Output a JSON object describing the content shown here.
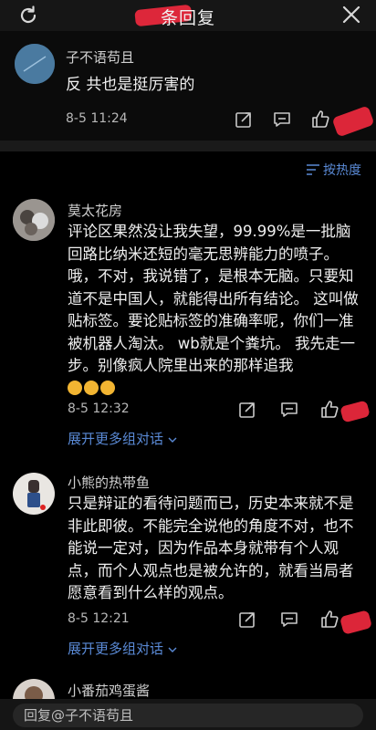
{
  "header": {
    "title": "条回复"
  },
  "root_comment": {
    "author": "子不语苟且",
    "content": "反 共也是挺厉害的",
    "time": "8-5 11:24"
  },
  "sort": {
    "label": "按热度"
  },
  "comments": [
    {
      "author": "莫太花房",
      "content": "评论区果然没让我失望，99.99%是一批脑回路比纳米还短的毫无思辨能力的喷子。哦，不对，我说错了，是根本无脑。只要知道不是中国人，就能得出所有结论。 这叫做贴标签。要论贴标签的准确率呢，你们一准被机器人淘汰。 wb就是个粪坑。 我先走一步。别像疯人院里出来的那样追我",
      "time": "8-5 12:32",
      "expand": "展开更多组对话"
    },
    {
      "author": "小熊的热带鱼",
      "content": "只是辩证的看待问题而已，历史本来就不是非此即彼。不能完全说他的角度不对，也不能说一定对，因为作品本身就带有个人观点，而个人观点也是被允许的，就看当局者愿意看到什么样的观点。",
      "time": "8-5 12:21",
      "expand": "展开更多组对话"
    },
    {
      "author": "小番茄鸡蛋酱"
    }
  ],
  "reply_input": {
    "placeholder": "回复@子不语苟且"
  },
  "icons": [
    "refresh-icon",
    "close-icon",
    "share-icon",
    "comment-icon",
    "like-icon",
    "sort-icon",
    "chevron-down-icon"
  ],
  "colors": {
    "background": "#000000",
    "link": "#5a8ad6",
    "redaction": "#e8283c"
  }
}
